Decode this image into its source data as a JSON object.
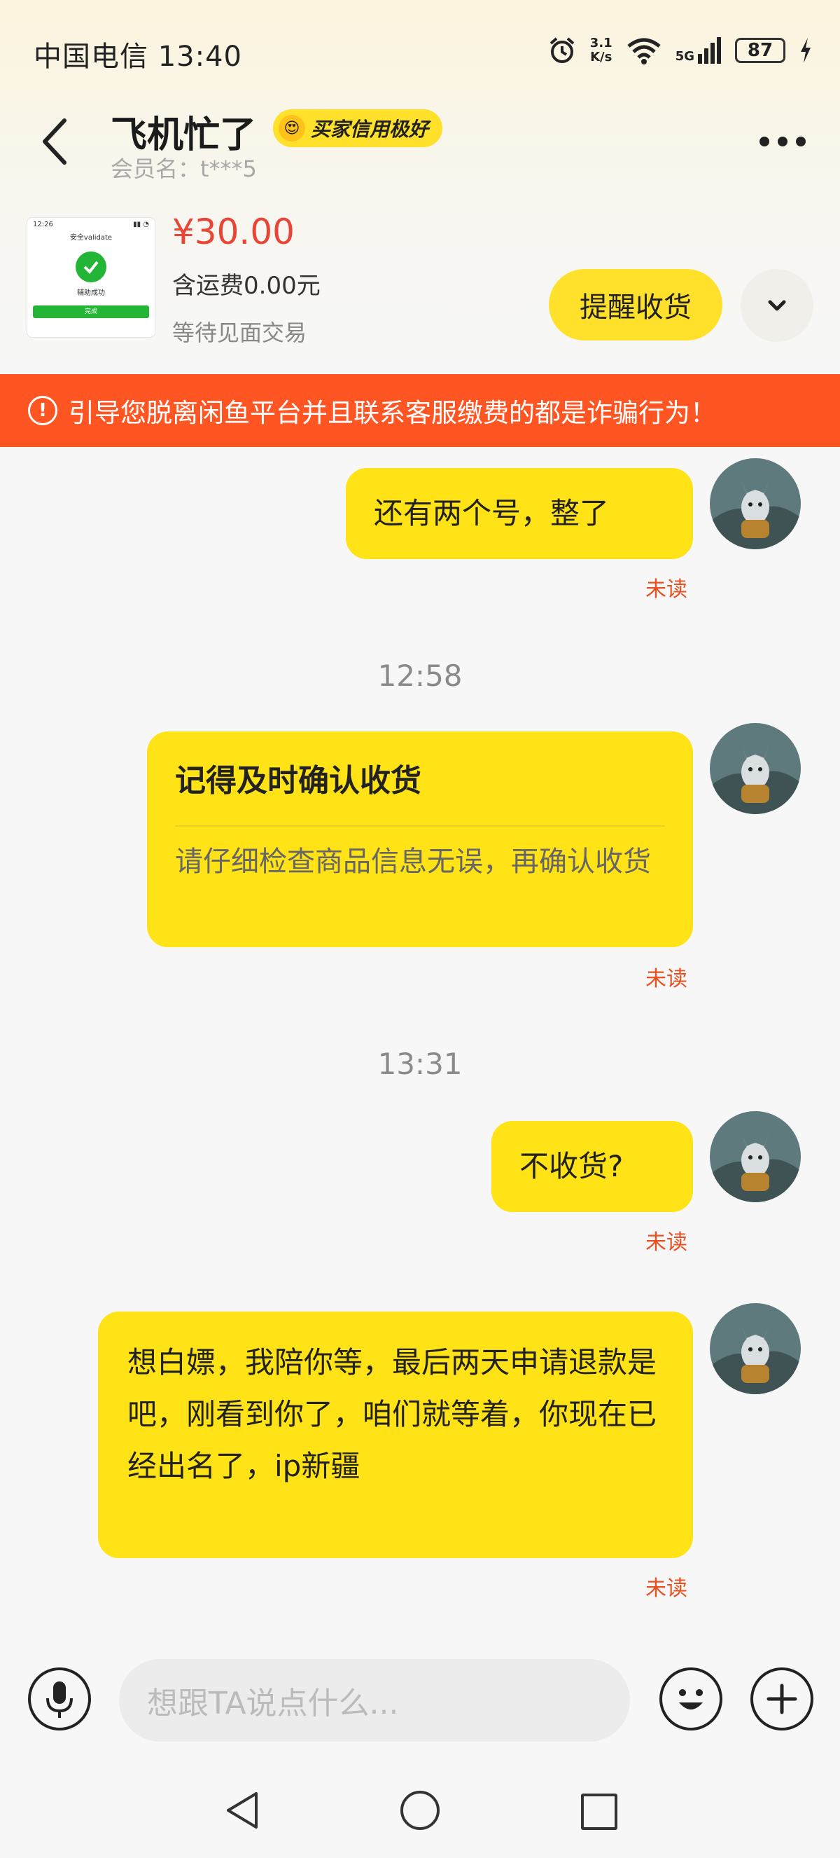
{
  "status_bar": {
    "carrier_time": "中国电信 13:40",
    "net_speed_value": "3.1",
    "net_speed_unit": "K/s",
    "network": "5G",
    "battery": "87"
  },
  "header": {
    "title": "飞机忙了",
    "credit_badge": "买家信用极好",
    "member_id": "会员名：t***5"
  },
  "product": {
    "price": "¥30.00",
    "shipping": "含运费0.00元",
    "status": "等待见面交易",
    "remind_label": "提醒收货",
    "thumb": {
      "time": "12:26",
      "title": "安全validate",
      "success": "辅助成功",
      "button": "完成"
    }
  },
  "warning": {
    "text": "引导您脱离闲鱼平台并且联系客服缴费的都是诈骗行为！"
  },
  "messages": [
    {
      "text": "还有两个号，整了",
      "unread": "未读"
    },
    {
      "timestamp": "12:58"
    },
    {
      "card_title": "记得及时确认收货",
      "card_body": "请仔细检查商品信息无误，再确认收货",
      "unread": "未读"
    },
    {
      "timestamp": "13:31"
    },
    {
      "text": "不收货?",
      "unread": "未读"
    },
    {
      "text": "想白嫖，我陪你等，最后两天申请退款是吧，刚看到你了，咱们就等着，你现在已经出名了，ip新疆",
      "unread": "未读"
    }
  ],
  "input": {
    "placeholder": "想跟TA说点什么..."
  },
  "colors": {
    "bubble": "#ffe316",
    "accent": "#ffe12b",
    "warning": "#ff5523",
    "price": "#e84537",
    "unread": "#e8501f"
  },
  "icons": [
    "back-arrow-icon",
    "more-icon",
    "chevron-down-icon",
    "warning-icon",
    "microphone-icon",
    "emoji-icon",
    "plus-icon",
    "nav-back-icon",
    "nav-home-icon",
    "nav-recent-icon",
    "alarm-icon",
    "wifi-icon",
    "signal-icon",
    "charging-icon"
  ]
}
